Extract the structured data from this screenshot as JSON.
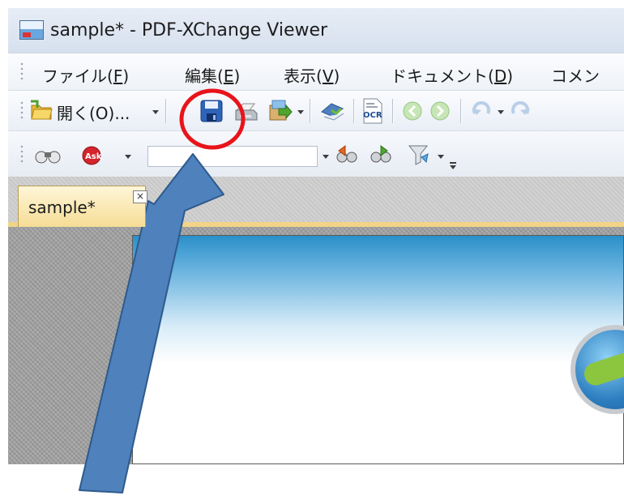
{
  "window": {
    "title": "sample* - PDF-XChange Viewer"
  },
  "menu": {
    "items": [
      {
        "label_prefix": "ファイル(",
        "mnemonic": "F",
        "label_suffix": ")"
      },
      {
        "label_prefix": "編集(",
        "mnemonic": "E",
        "label_suffix": ")"
      },
      {
        "label_prefix": "表示(",
        "mnemonic": "V",
        "label_suffix": ")"
      },
      {
        "label_prefix": "ドキュメント(",
        "mnemonic": "D",
        "label_suffix": ")"
      },
      {
        "label_prefix": "コメン",
        "mnemonic": "",
        "label_suffix": ""
      }
    ]
  },
  "toolbar": {
    "open_label": "開く(O)...",
    "ocr_label": "OCR",
    "icons": [
      "open-folder-icon",
      "save-icon",
      "print-icon",
      "export-icon",
      "scan-icon",
      "ocr-icon",
      "back-icon",
      "forward-icon",
      "undo-icon",
      "redo-icon"
    ]
  },
  "find_toolbar": {
    "search_value": "",
    "icons": [
      "binoculars-icon",
      "ask-search-icon",
      "find-previous-icon",
      "find-next-icon",
      "highlight-icon"
    ]
  },
  "tabs": {
    "active": "sample*",
    "close_glyph": "×"
  },
  "annotation": {
    "circle_color": "#e8141a",
    "arrow_fill": "#4f81bd",
    "arrow_stroke": "#2e5a8c"
  }
}
